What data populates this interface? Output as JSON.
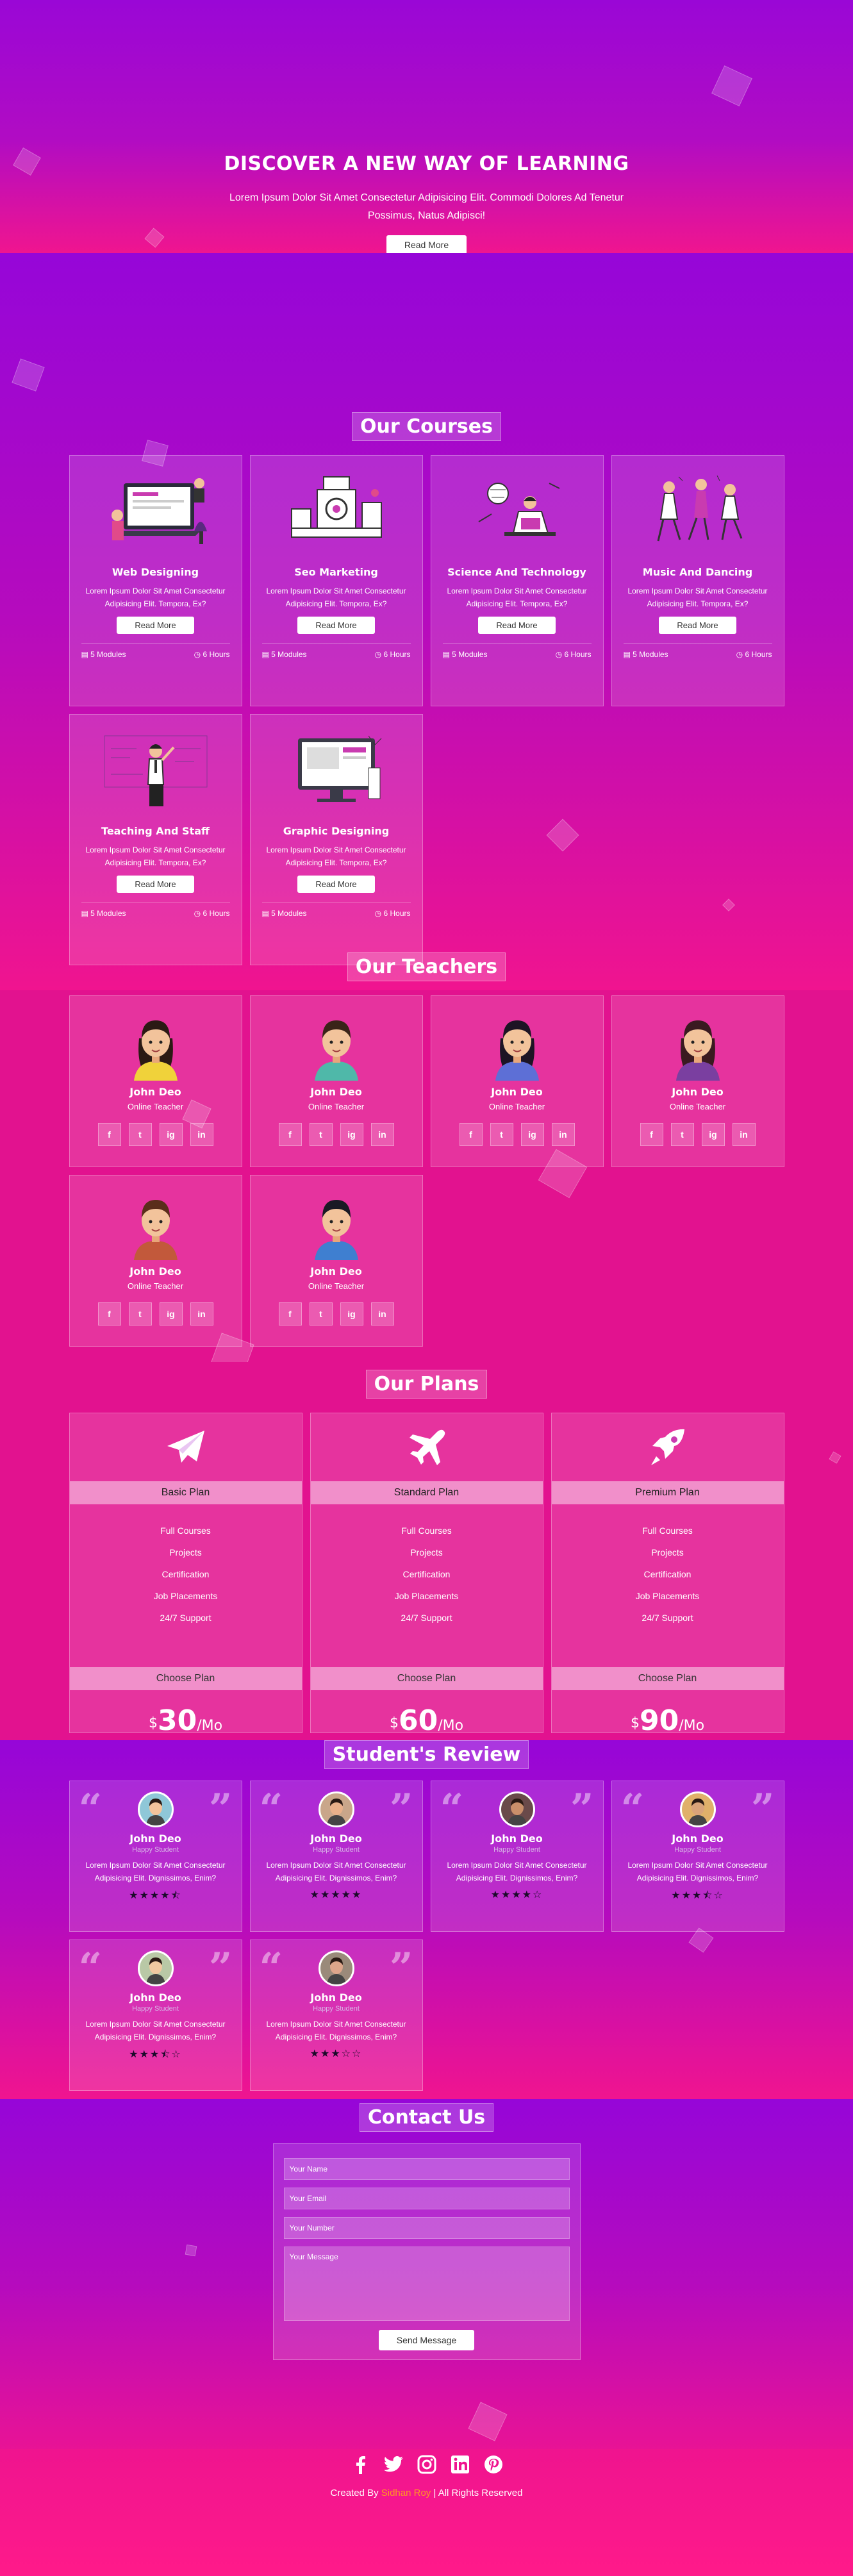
{
  "home": {
    "title": "DISCOVER A NEW WAY OF LEARNING",
    "text": "Lorem Ipsum Dolor Sit Amet Consectetur Adipisicing Elit. Commodi Dolores Ad Tenetur Possimus, Natus Adipisci!",
    "button": "Read More"
  },
  "courses": {
    "heading": "Our Courses",
    "items": [
      {
        "name": "Web Designing",
        "desc": "Lorem Ipsum Dolor Sit Amet Consectetur Adipisicing Elit. Tempora, Ex?",
        "button": "Read More",
        "modules": "5 Modules",
        "hours": "6 Hours",
        "art": "laptop-illustration"
      },
      {
        "name": "Seo Marketing",
        "desc": "Lorem Ipsum Dolor Sit Amet Consectetur Adipisicing Elit. Tempora, Ex?",
        "button": "Read More",
        "modules": "5 Modules",
        "hours": "6 Hours",
        "art": "machine-illustration"
      },
      {
        "name": "Science And Technology",
        "desc": "Lorem Ipsum Dolor Sit Amet Consectetur Adipisicing Elit. Tempora, Ex?",
        "button": "Read More",
        "modules": "5 Modules",
        "hours": "6 Hours",
        "art": "reading-illustration"
      },
      {
        "name": "Music And Dancing",
        "desc": "Lorem Ipsum Dolor Sit Amet Consectetur Adipisicing Elit. Tempora, Ex?",
        "button": "Read More",
        "modules": "5 Modules",
        "hours": "6 Hours",
        "art": "dancers-illustration"
      },
      {
        "name": "Teaching And Staff",
        "desc": "Lorem Ipsum Dolor Sit Amet Consectetur Adipisicing Elit. Tempora, Ex?",
        "button": "Read More",
        "modules": "5 Modules",
        "hours": "6 Hours",
        "art": "teacher-illustration"
      },
      {
        "name": "Graphic Designing",
        "desc": "Lorem Ipsum Dolor Sit Amet Consectetur Adipisicing Elit. Tempora, Ex?",
        "button": "Read More",
        "modules": "5 Modules",
        "hours": "6 Hours",
        "art": "monitor-illustration"
      }
    ]
  },
  "teachers": {
    "heading": "Our Teachers",
    "items": [
      {
        "name": "John Deo",
        "role": "Online Teacher",
        "shirt": "#f0d23a",
        "hair": "#2b1a14",
        "long": true
      },
      {
        "name": "John Deo",
        "role": "Online Teacher",
        "shirt": "#4fb8a9",
        "hair": "#3a2418",
        "long": false
      },
      {
        "name": "John Deo",
        "role": "Online Teacher",
        "shirt": "#5d6fd6",
        "hair": "#1d1424",
        "long": true
      },
      {
        "name": "John Deo",
        "role": "Online Teacher",
        "shirt": "#7a3fa0",
        "hair": "#3a1a20",
        "long": true
      },
      {
        "name": "John Deo",
        "role": "Online Teacher",
        "shirt": "#c2593b",
        "hair": "#5a2e1a",
        "long": false
      },
      {
        "name": "John Deo",
        "role": "Online Teacher",
        "shirt": "#3f7fd0",
        "hair": "#1a1a24",
        "long": false
      }
    ],
    "social": [
      "f",
      "t",
      "ig",
      "in"
    ]
  },
  "plans": {
    "heading": "Our Plans",
    "items": [
      {
        "name": "Basic Plan",
        "icon": "paper-plane-icon",
        "features": [
          "Full Courses",
          "Projects",
          "Certification",
          "Job Placements",
          "24/7 Support"
        ],
        "button": "Choose Plan",
        "currency": "$",
        "price": "30",
        "period": "/Mo"
      },
      {
        "name": "Standard Plan",
        "icon": "airplane-icon",
        "features": [
          "Full Courses",
          "Projects",
          "Certification",
          "Job Placements",
          "24/7 Support"
        ],
        "button": "Choose Plan",
        "currency": "$",
        "price": "60",
        "period": "/Mo"
      },
      {
        "name": "Premium Plan",
        "icon": "rocket-icon",
        "features": [
          "Full Courses",
          "Projects",
          "Certification",
          "Job Placements",
          "24/7 Support"
        ],
        "button": "Choose Plan",
        "currency": "$",
        "price": "90",
        "period": "/Mo"
      }
    ]
  },
  "reviews": {
    "heading": "Student's Review",
    "items": [
      {
        "name": "John Deo",
        "role": "Happy Student",
        "text": "Lorem Ipsum Dolor Sit Amet Consectetur Adipisicing Elit. Dignissimos, Enim?",
        "stars": "★★★★⯪",
        "skin": "#f2c39b",
        "bg": "#8fc7d8"
      },
      {
        "name": "John Deo",
        "role": "Happy Student",
        "text": "Lorem Ipsum Dolor Sit Amet Consectetur Adipisicing Elit. Dignissimos, Enim?",
        "stars": "★★★★★",
        "skin": "#e8b08a",
        "bg": "#c9a68a"
      },
      {
        "name": "John Deo",
        "role": "Happy Student",
        "text": "Lorem Ipsum Dolor Sit Amet Consectetur Adipisicing Elit. Dignissimos, Enim?",
        "stars": "★★★★☆",
        "skin": "#c98f6a",
        "bg": "#6a4a4a"
      },
      {
        "name": "John Deo",
        "role": "Happy Student",
        "text": "Lorem Ipsum Dolor Sit Amet Consectetur Adipisicing Elit. Dignissimos, Enim?",
        "stars": "★★★⯪☆",
        "skin": "#d9a37a",
        "bg": "#e0b06a"
      },
      {
        "name": "John Deo",
        "role": "Happy Student",
        "text": "Lorem Ipsum Dolor Sit Amet Consectetur Adipisicing Elit. Dignissimos, Enim?",
        "stars": "★★★⯪☆",
        "skin": "#f0c8a0",
        "bg": "#b9c8a6"
      },
      {
        "name": "John Deo",
        "role": "Happy Student",
        "text": "Lorem Ipsum Dolor Sit Amet Consectetur Adipisicing Elit. Dignissimos, Enim?",
        "stars": "★★★☆☆",
        "skin": "#dca58a",
        "bg": "#9a8a7a"
      }
    ]
  },
  "contact": {
    "heading": "Contact Us",
    "name_placeholder": "Your Name",
    "email_placeholder": "Your Email",
    "number_placeholder": "Your Number",
    "message_placeholder": "Your Message",
    "button": "Send Message"
  },
  "footer": {
    "icons": [
      "facebook-icon",
      "twitter-icon",
      "instagram-icon",
      "linkedin-icon",
      "pinterest-icon"
    ],
    "credit_prefix": "Created By",
    "credit_brand": "Sidhan Roy",
    "credit_suffix": "| All Rights Reserved",
    "brand_color": "#ff9a1f"
  }
}
